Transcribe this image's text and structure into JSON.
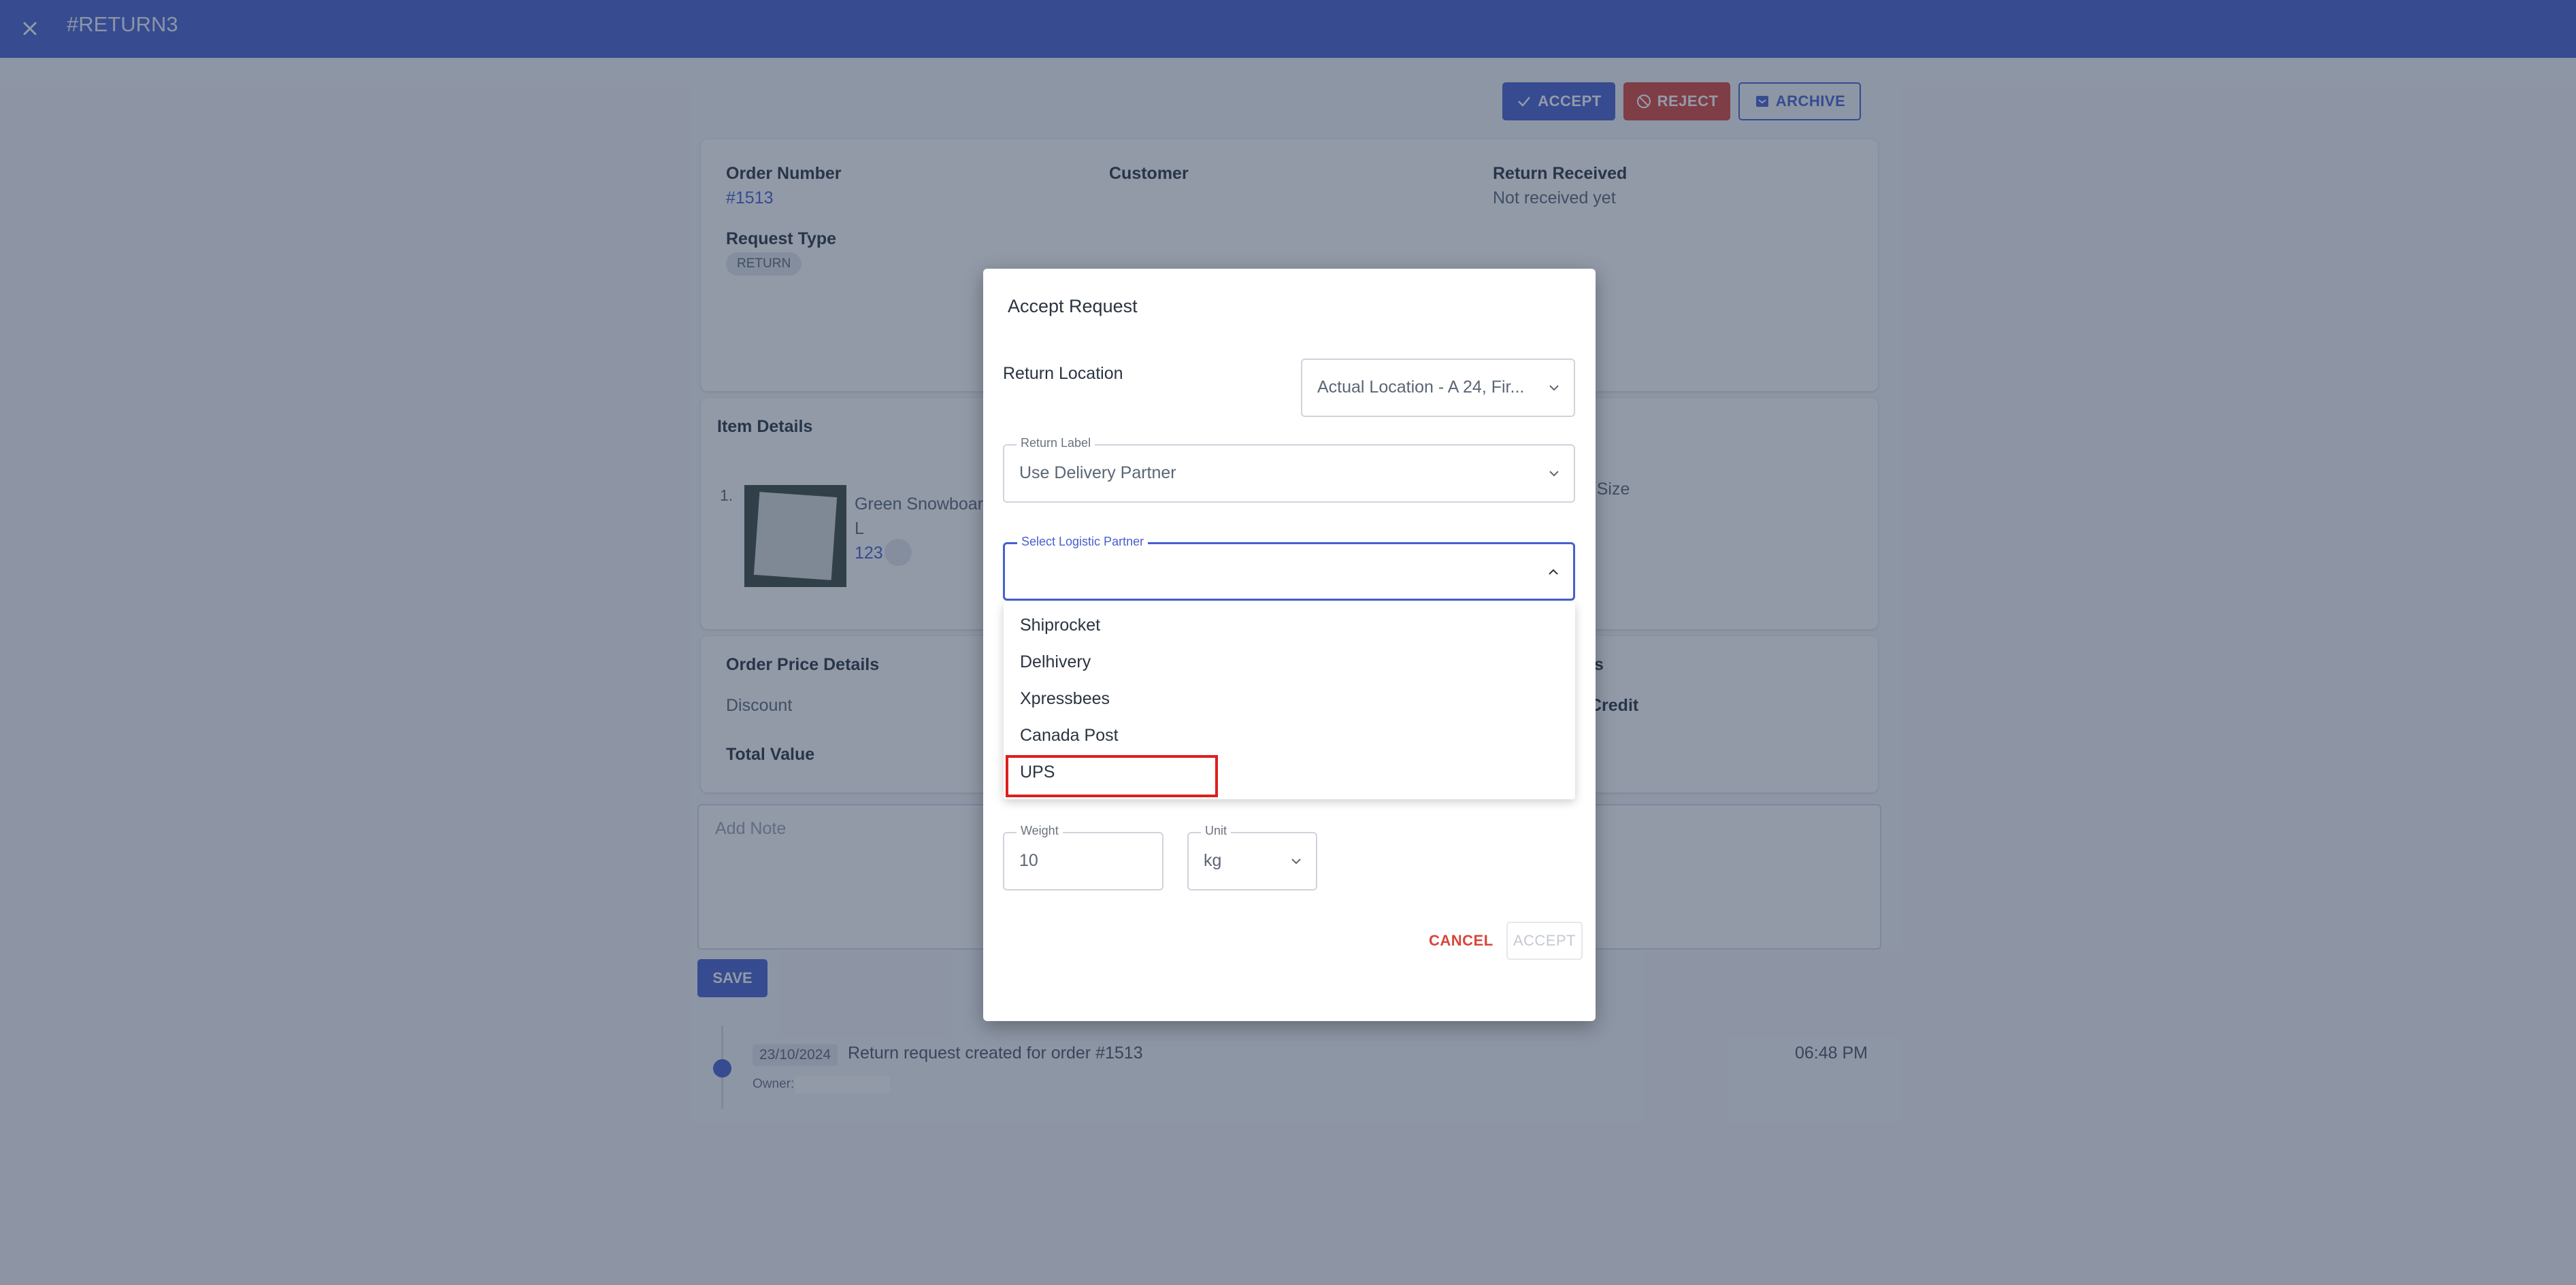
{
  "header": {
    "title": "#RETURN3"
  },
  "actions": {
    "accept": "ACCEPT",
    "reject": "REJECT",
    "archive": "ARCHIVE"
  },
  "summary": {
    "order_number_label": "Order Number",
    "order_number": "#1513",
    "customer_label": "Customer",
    "return_received_label": "Return Received",
    "return_received": "Not received yet",
    "request_type_label": "Request Type",
    "request_type": "RETURN"
  },
  "items": {
    "title": "Item Details",
    "index": "1.",
    "name": "Green Snowboar",
    "variant": "L",
    "sku": "123",
    "right_label": "ng Size"
  },
  "price": {
    "title": "Order Price Details",
    "discount_label": "Discount",
    "total_label": "Total Value",
    "right_title": "ls",
    "right_credit": "Credit"
  },
  "note": {
    "placeholder": "Add Note",
    "save": "SAVE"
  },
  "timeline": {
    "date": "23/10/2024",
    "text": "Return request created for order #1513",
    "owner_label": "Owner:",
    "time": "06:48 PM"
  },
  "modal": {
    "title": "Accept Request",
    "return_location_label": "Return Location",
    "return_location_value": "Actual Location - A 24, Fir...",
    "return_label_label": "Return Label",
    "return_label_value": "Use Delivery Partner",
    "logistic_label": "Select Logistic Partner",
    "logistic_options": [
      "Shiprocket",
      "Delhivery",
      "Xpressbees",
      "Canada Post",
      "UPS"
    ],
    "weight_label": "Weight",
    "weight_value": "10",
    "unit_label": "Unit",
    "unit_value": "kg",
    "cancel": "CANCEL",
    "accept": "ACCEPT"
  }
}
